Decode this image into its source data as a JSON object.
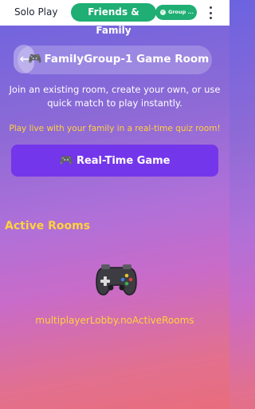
{
  "tabs": {
    "solo": "Solo Play",
    "family": "Friends & Family"
  },
  "group_chip": {
    "label": "Group ...",
    "icon": "check-circle-icon"
  },
  "menu": {
    "icon": "more-vert-icon"
  },
  "room": {
    "back_icon": "back-arrow-icon",
    "icon": "🎮",
    "title": "FamilyGroup-1 Game Room"
  },
  "description": "Join an existing room, create your own, or use quick match to play instantly.",
  "tagline": "Play live with your family in a real-time quiz room!",
  "realtime_button": {
    "icon": "🎮",
    "label": "Real-Time Game"
  },
  "active_rooms": {
    "heading": "Active Rooms",
    "empty_icon": "game-controller-icon",
    "empty_text": "multiplayerLobby.noActiveRooms"
  },
  "colors": {
    "accent_green": "#1fae73",
    "accent_purple": "#7436ea",
    "highlight_yellow": "#ffd23d"
  }
}
